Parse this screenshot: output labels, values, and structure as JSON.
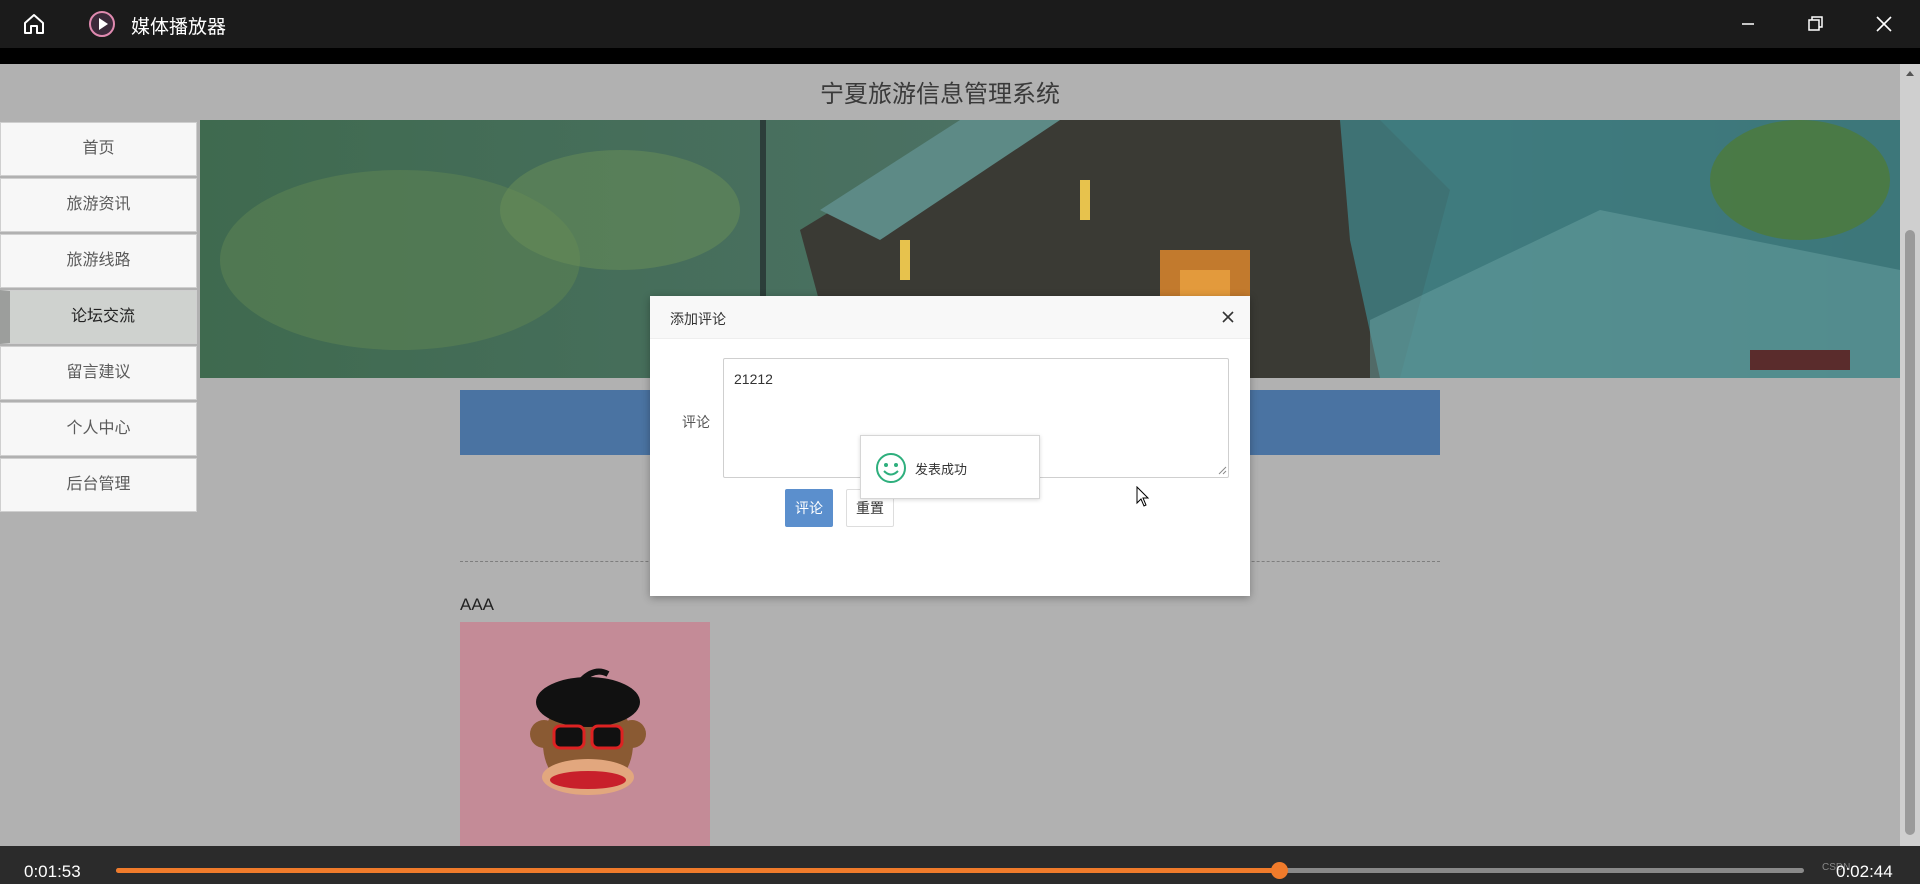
{
  "player": {
    "title": "媒体播放器",
    "current_time": "0:01:53",
    "total_time": "0:02:44",
    "progress_fraction": 0.689,
    "watermark": "CSDN",
    "accent_color": "#f07b2b"
  },
  "site": {
    "title": "宁夏旅游信息管理系统",
    "nav": [
      {
        "label": "首页"
      },
      {
        "label": "旅游资讯"
      },
      {
        "label": "旅游线路"
      },
      {
        "label": "论坛交流",
        "active": true
      },
      {
        "label": "留言建议"
      },
      {
        "label": "个人中心"
      },
      {
        "label": "后台管理"
      }
    ],
    "post_author": "AAA"
  },
  "modal": {
    "title": "添加评论",
    "field_label": "评论",
    "comment_value": "21212",
    "submit_label": "评论",
    "reset_label": "重置"
  },
  "toast": {
    "message": "发表成功",
    "icon": "smile-icon",
    "icon_color": "#2eaf7d"
  }
}
